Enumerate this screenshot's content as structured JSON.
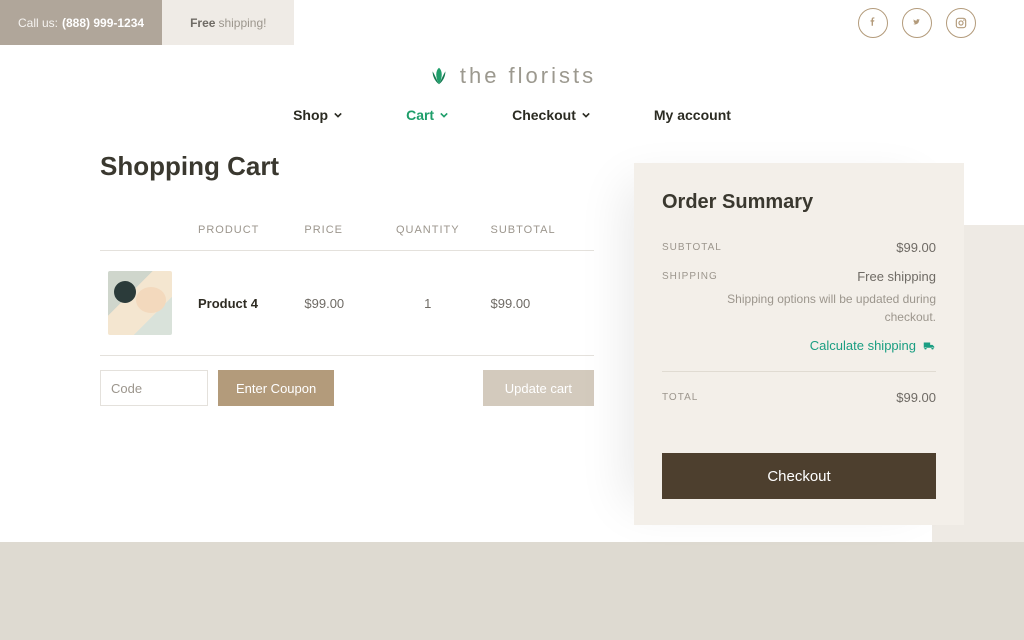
{
  "topbar": {
    "call_prefix": "Call us:",
    "phone": "(888) 999-1234",
    "ship_bold": "Free",
    "ship_rest": "shipping!"
  },
  "brand": {
    "name": "the florists"
  },
  "nav": {
    "shop": "Shop",
    "cart": "Cart",
    "checkout": "Checkout",
    "account": "My account"
  },
  "page": {
    "title": "Shopping Cart"
  },
  "table": {
    "head": {
      "product": "PRODUCT",
      "price": "PRICE",
      "quantity": "QUANTITY",
      "subtotal": "SUBTOTAL"
    },
    "row": {
      "name": "Product 4",
      "price": "$99.00",
      "qty": "1",
      "subtotal": "$99.00"
    }
  },
  "coupon": {
    "placeholder": "Code",
    "button": "Enter Coupon"
  },
  "update": {
    "label": "Update cart"
  },
  "summary": {
    "title": "Order Summary",
    "subtotal_label": "SUBTOTAL",
    "subtotal_value": "$99.00",
    "shipping_label": "SHIPPING",
    "shipping_value": "Free shipping",
    "shipping_note": "Shipping options will be updated during checkout.",
    "calc": "Calculate shipping",
    "total_label": "TOTAL",
    "total_value": "$99.00",
    "checkout": "Checkout"
  }
}
